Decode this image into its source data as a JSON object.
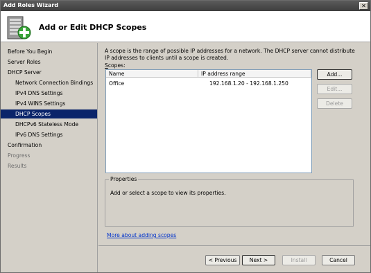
{
  "window": {
    "title": "Add Roles Wizard",
    "close_glyph": "✕"
  },
  "header": {
    "title": "Add or Edit DHCP Scopes",
    "icon": "server-add-icon"
  },
  "sidebar": {
    "items": [
      {
        "label": "Before You Begin",
        "level": 0,
        "state": "normal"
      },
      {
        "label": "Server Roles",
        "level": 0,
        "state": "normal"
      },
      {
        "label": "DHCP Server",
        "level": 0,
        "state": "normal"
      },
      {
        "label": "Network Connection Bindings",
        "level": 1,
        "state": "normal"
      },
      {
        "label": "IPv4 DNS Settings",
        "level": 1,
        "state": "normal"
      },
      {
        "label": "IPv4 WINS Settings",
        "level": 1,
        "state": "normal"
      },
      {
        "label": "DHCP Scopes",
        "level": 1,
        "state": "selected"
      },
      {
        "label": "DHCPv6 Stateless Mode",
        "level": 1,
        "state": "normal"
      },
      {
        "label": "IPv6 DNS Settings",
        "level": 1,
        "state": "normal"
      },
      {
        "label": "Confirmation",
        "level": 0,
        "state": "normal"
      },
      {
        "label": "Progress",
        "level": 0,
        "state": "disabled"
      },
      {
        "label": "Results",
        "level": 0,
        "state": "disabled"
      }
    ]
  },
  "main": {
    "description": "A scope is the range of possible IP addresses for a network. The DHCP server cannot distribute IP addresses to clients until a scope is created.",
    "scopes_label_mnemonic": "S",
    "scopes_label_rest": "copes:",
    "table": {
      "columns": [
        "Name",
        "IP address range"
      ],
      "rows": [
        {
          "name": "Office",
          "range": "192.168.1.20 - 192.168.1.250"
        }
      ]
    },
    "buttons": {
      "add": "Add...",
      "edit": "Edit...",
      "delete": "Delete"
    },
    "properties": {
      "legend": "Properties",
      "text": "Add or select a scope to view its properties."
    },
    "link": "More about adding scopes"
  },
  "footer": {
    "previous": "< Previous",
    "next": "Next >",
    "install": "Install",
    "cancel": "Cancel"
  },
  "colors": {
    "selection": "#0a246a",
    "link": "#0033cc",
    "chrome": "#d4d0c8"
  }
}
